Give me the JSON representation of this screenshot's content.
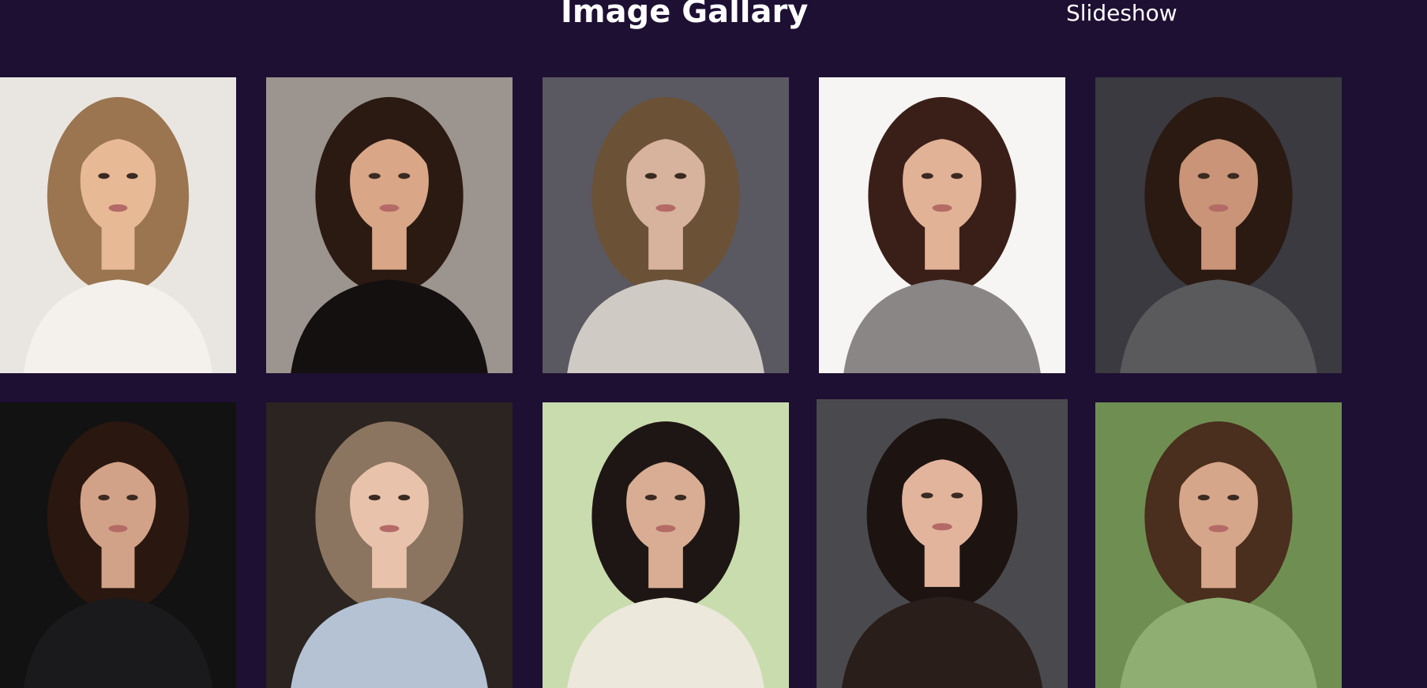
{
  "header": {
    "title": "Image Gallary",
    "nav_link": "Slideshow"
  },
  "gallery": {
    "images": [
      {
        "name": "portrait-1",
        "colors": {
          "bg": "#e9e6e2",
          "hair": "#9a7550",
          "skin": "#e7b995",
          "top": "#f4f1ec"
        }
      },
      {
        "name": "portrait-2",
        "colors": {
          "bg": "#9c948e",
          "hair": "#2a1a12",
          "skin": "#d9a688",
          "top": "#141010"
        }
      },
      {
        "name": "portrait-3",
        "colors": {
          "bg": "#5a5860",
          "hair": "#6b5237",
          "skin": "#d7b29c",
          "top": "#cfcac4"
        }
      },
      {
        "name": "portrait-4",
        "colors": {
          "bg": "#f7f5f3",
          "hair": "#3a1f18",
          "skin": "#e2b296",
          "top": "#8a8686"
        }
      },
      {
        "name": "portrait-5",
        "colors": {
          "bg": "#3a3a40",
          "hair": "#2b1a12",
          "skin": "#c99478",
          "top": "#5a5a5c"
        }
      },
      {
        "name": "portrait-6",
        "colors": {
          "bg": "#121212",
          "hair": "#2a1710",
          "skin": "#d2a288",
          "top": "#1a1a1c"
        }
      },
      {
        "name": "portrait-7",
        "colors": {
          "bg": "#2b2420",
          "hair": "#8c7560",
          "skin": "#e9c2ac",
          "top": "#b4c2d4"
        }
      },
      {
        "name": "portrait-8",
        "colors": {
          "bg": "#c9dcae",
          "hair": "#1e1614",
          "skin": "#d8ad94",
          "top": "#ece8dc"
        }
      },
      {
        "name": "portrait-9",
        "colors": {
          "bg": "#4a4a4e",
          "hair": "#1d1412",
          "skin": "#e3b49c",
          "top": "#2a1e1a"
        }
      },
      {
        "name": "portrait-10",
        "colors": {
          "bg": "#6f8f52",
          "hair": "#4a2e1e",
          "skin": "#d6a68a",
          "top": "#8fae72"
        }
      }
    ]
  }
}
